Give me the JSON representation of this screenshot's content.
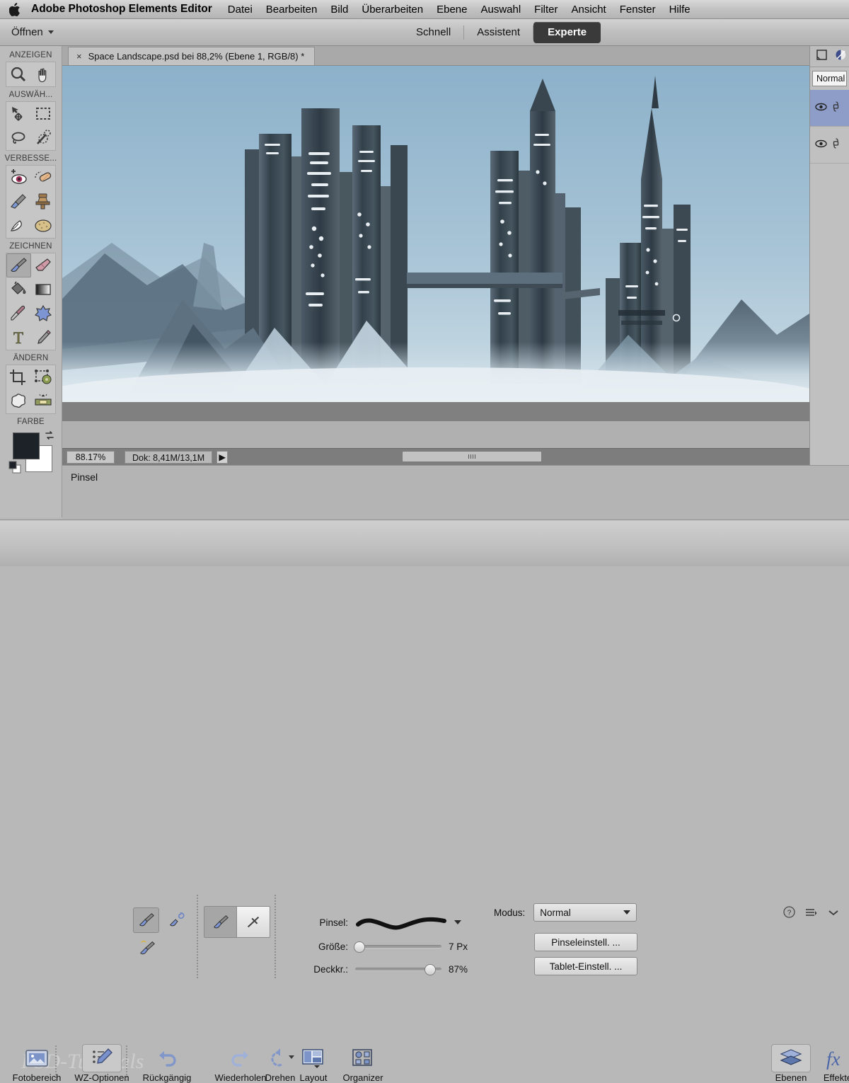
{
  "menubar": {
    "apple_icon": "apple-logo",
    "app_title": "Adobe Photoshop Elements Editor",
    "items": [
      {
        "label": "Datei"
      },
      {
        "label": "Bearbeiten"
      },
      {
        "label": "Bild"
      },
      {
        "label": "Überarbeiten"
      },
      {
        "label": "Ebene"
      },
      {
        "label": "Auswahl"
      },
      {
        "label": "Filter"
      },
      {
        "label": "Ansicht"
      },
      {
        "label": "Fenster"
      },
      {
        "label": "Hilfe"
      }
    ]
  },
  "modebar": {
    "open_label": "Öffnen",
    "tabs": [
      {
        "label": "Schnell",
        "active": false
      },
      {
        "label": "Assistent",
        "active": false
      },
      {
        "label": "Experte",
        "active": true
      }
    ]
  },
  "document": {
    "tab_title": "Space Landscape.psd bei 88,2% (Ebene 1, RGB/8) *",
    "close_glyph": "×"
  },
  "toolbox": {
    "sections": [
      {
        "label": "ANZEIGEN",
        "tools": [
          {
            "name": "zoom-tool",
            "selected": false
          },
          {
            "name": "hand-tool",
            "selected": false
          }
        ]
      },
      {
        "label": "AUSWÄH...",
        "tools": [
          {
            "name": "move-tool",
            "selected": false
          },
          {
            "name": "rectangular-marquee-tool",
            "selected": false
          },
          {
            "name": "lasso-tool",
            "selected": false
          },
          {
            "name": "magic-wand-tool",
            "selected": false
          }
        ]
      },
      {
        "label": "VERBESSE...",
        "tools": [
          {
            "name": "red-eye-removal-tool",
            "selected": false
          },
          {
            "name": "spot-healing-brush-tool",
            "selected": false
          },
          {
            "name": "smart-brush-tool",
            "selected": false
          },
          {
            "name": "clone-stamp-tool",
            "selected": false
          },
          {
            "name": "blur-tool",
            "selected": false
          },
          {
            "name": "sponge-tool",
            "selected": false
          }
        ]
      },
      {
        "label": "ZEICHNEN",
        "tools": [
          {
            "name": "brush-tool",
            "selected": true
          },
          {
            "name": "eraser-tool",
            "selected": false
          },
          {
            "name": "paint-bucket-tool",
            "selected": false
          },
          {
            "name": "gradient-tool",
            "selected": false
          },
          {
            "name": "eyedropper-tool",
            "selected": false
          },
          {
            "name": "custom-shape-tool",
            "selected": false
          },
          {
            "name": "type-tool",
            "selected": false
          },
          {
            "name": "pencil-tool",
            "selected": false
          }
        ]
      },
      {
        "label": "ÄNDERN",
        "tools": [
          {
            "name": "crop-tool",
            "selected": false
          },
          {
            "name": "recompose-tool",
            "selected": false
          },
          {
            "name": "cookie-cutter-tool",
            "selected": false
          },
          {
            "name": "straighten-tool",
            "selected": false
          }
        ]
      }
    ],
    "color_section_label": "FARBE",
    "foreground_color": "#1d2128",
    "background_color": "#ffffff"
  },
  "statusbar": {
    "zoom_value": "88.17%",
    "doc_info": "Dok: 8,41M/13,1M",
    "arrow_glyph": "▶"
  },
  "options": {
    "title": "Pinsel",
    "tool_buttons": [
      {
        "name": "brush-tool-option",
        "selected": true
      },
      {
        "name": "impressionist-brush-option",
        "selected": false
      },
      {
        "name": "color-replacement-brush-option",
        "selected": false
      }
    ],
    "segment": [
      {
        "name": "brush-mode",
        "selected": true
      },
      {
        "name": "airbrush-mode",
        "selected": false
      }
    ],
    "brush_label": "Pinsel:",
    "size_label": "Größe:",
    "size_value": "7 Px",
    "size_percent": 4,
    "opacity_label": "Deckkr.:",
    "opacity_value": "87%",
    "opacity_percent": 87,
    "mode_label": "Modus:",
    "mode_value": "Normal",
    "brush_settings_button": "Pinseleinstell. ...",
    "tablet_settings_button": "Tablet-Einstell. ...",
    "help_icon": "help-icon",
    "menu_icon": "panel-menu-icon",
    "collapse_icon": "chevron-down-icon"
  },
  "rightpanel": {
    "new_layer_icon": "new-layer-icon",
    "adjustment_layer_icon": "adjustment-layer-icon",
    "blend_mode": "Normal",
    "layers": [
      {
        "name": "layer-row-1",
        "visible_icon": "eye-icon",
        "link_icon": "link-icon",
        "selected": true
      },
      {
        "name": "layer-row-2",
        "visible_icon": "eye-icon",
        "link_icon": "link-icon",
        "selected": false
      }
    ]
  },
  "taskbar": {
    "items": [
      {
        "label": "Fotobereich",
        "icon": "photo-bin-icon",
        "selected": false
      },
      {
        "label": "WZ-Optionen",
        "icon": "tool-options-icon",
        "selected": true
      },
      {
        "label": "Rückgängig",
        "icon": "undo-icon",
        "selected": false
      },
      {
        "label": "Wiederholen",
        "icon": "redo-icon",
        "selected": false
      },
      {
        "label": "Drehen",
        "icon": "rotate-icon",
        "selected": false
      },
      {
        "label": "Layout",
        "icon": "layout-icon",
        "selected": false
      },
      {
        "label": "Organizer",
        "icon": "organizer-icon",
        "selected": false
      }
    ],
    "right_items": [
      {
        "label": "Ebenen",
        "icon": "layers-icon",
        "selected": true
      },
      {
        "label": "Effekte",
        "icon": "effects-fx-icon",
        "selected": false
      }
    ]
  },
  "watermark": "PSD-Tutorials",
  "colors": {
    "sky_top": "#8fb3cb",
    "sky_bottom": "#c9dbe6",
    "tower_dark": "#39464f",
    "tower_mid": "#56697a",
    "snow": "#dde8ee",
    "accent_selected": "#8e9cc8"
  }
}
